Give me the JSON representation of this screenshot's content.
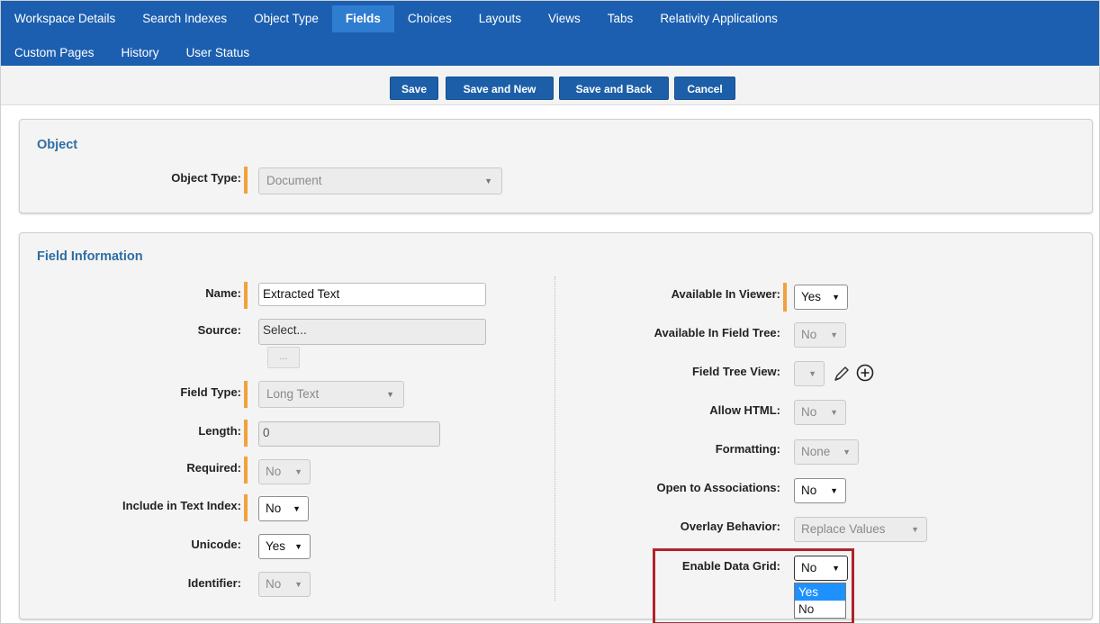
{
  "nav": {
    "row1": [
      "Workspace Details",
      "Search Indexes",
      "Object Type",
      "Fields",
      "Choices",
      "Layouts",
      "Views",
      "Tabs",
      "Relativity Applications"
    ],
    "row2": [
      "Custom Pages",
      "History",
      "User Status"
    ],
    "active": "Fields"
  },
  "actions": {
    "save": "Save",
    "save_new": "Save and New",
    "save_back": "Save and Back",
    "cancel": "Cancel"
  },
  "object_panel": {
    "title": "Object",
    "object_type_label": "Object Type:",
    "object_type_value": "Document"
  },
  "field_info": {
    "title": "Field Information",
    "left": {
      "name_label": "Name:",
      "name_value": "Extracted Text",
      "source_label": "Source:",
      "source_value": "Select...",
      "source_button": "...",
      "field_type_label": "Field Type:",
      "field_type_value": "Long Text",
      "length_label": "Length:",
      "length_value": "0",
      "required_label": "Required:",
      "required_value": "No",
      "include_text_index_label": "Include in Text Index:",
      "include_text_index_value": "No",
      "unicode_label": "Unicode:",
      "unicode_value": "Yes",
      "identifier_label": "Identifier:",
      "identifier_value": "No"
    },
    "right": {
      "available_viewer_label": "Available In Viewer:",
      "available_viewer_value": "Yes",
      "available_field_tree_label": "Available In Field Tree:",
      "available_field_tree_value": "No",
      "field_tree_view_label": "Field Tree View:",
      "allow_html_label": "Allow HTML:",
      "allow_html_value": "No",
      "formatting_label": "Formatting:",
      "formatting_value": "None",
      "open_assoc_label": "Open to Associations:",
      "open_assoc_value": "No",
      "overlay_label": "Overlay Behavior:",
      "overlay_value": "Replace Values",
      "data_grid_label": "Enable Data Grid:",
      "data_grid_value": "No",
      "data_grid_options": [
        "Yes",
        "No"
      ]
    }
  },
  "colors": {
    "nav_bg": "#1c5fb0",
    "nav_active": "#2f7dd0",
    "button": "#1c5fa8",
    "required_marker": "#f1a23b",
    "panel_title": "#2e6da4",
    "highlight": "#b2222a",
    "option_selected": "#1e90ff"
  }
}
